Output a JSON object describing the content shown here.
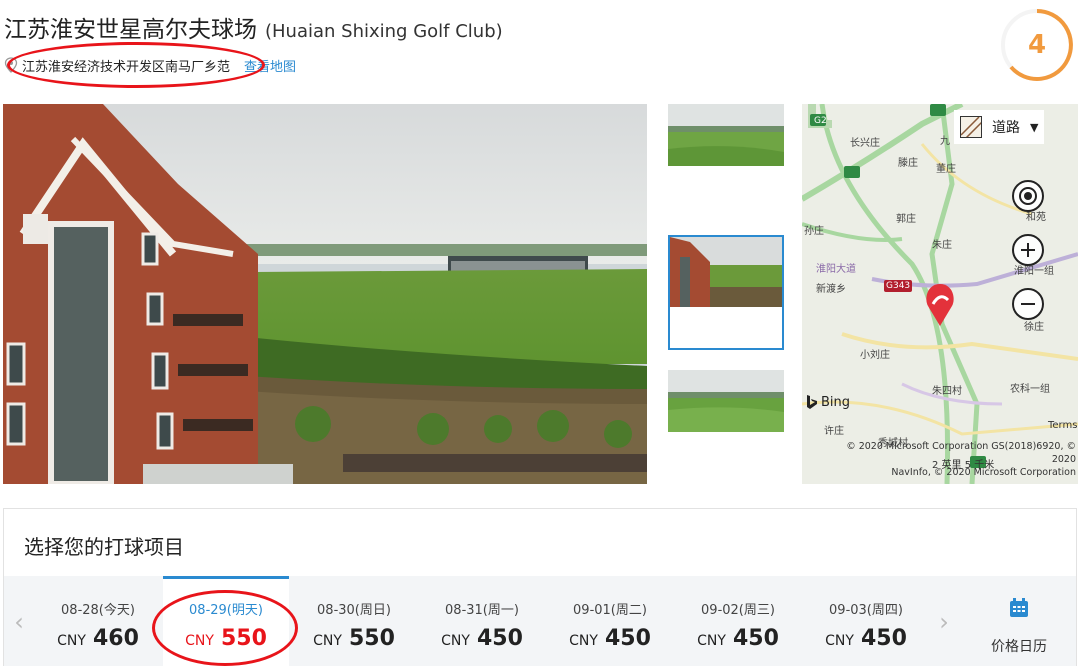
{
  "header": {
    "title_cn": "江苏淮安世星高尔夫球场",
    "title_en": "(Huaian Shixing Golf Club)",
    "address": "江苏淮安经济技术开发区南马厂乡范",
    "map_link": "查看地图",
    "score": "4"
  },
  "map": {
    "style_label": "道路",
    "labels": [
      "长兴庄",
      "九",
      "滕庄",
      "董庄",
      "孙庄",
      "郭庄",
      "朱庄",
      "淮阳大道",
      "新渡乡",
      "小刘庄",
      "朱四村",
      "农科一组",
      "许庄",
      "秀城村",
      "G2",
      "G343",
      "淮阳一组",
      "徐庄",
      "和苑"
    ],
    "provider": "Bing",
    "terms": "Terms",
    "copyright_line1": "© 2020 Microsoft Corporation GS(2018)6920, © 2020",
    "copyright_line2": "NavInfo, © 2020 Microsoft Corporation",
    "scale": "2 英里      5 千米"
  },
  "booking": {
    "section_title": "选择您的打球项目",
    "days": [
      {
        "date": "08-28(今天)",
        "currency": "CNY",
        "price": "460"
      },
      {
        "date": "08-29(明天)",
        "currency": "CNY",
        "price": "550"
      },
      {
        "date": "08-30(周日)",
        "currency": "CNY",
        "price": "550"
      },
      {
        "date": "08-31(周一)",
        "currency": "CNY",
        "price": "450"
      },
      {
        "date": "09-01(周二)",
        "currency": "CNY",
        "price": "450"
      },
      {
        "date": "09-02(周三)",
        "currency": "CNY",
        "price": "450"
      },
      {
        "date": "09-03(周四)",
        "currency": "CNY",
        "price": "450"
      }
    ],
    "selected_index": 1,
    "calendar_label": "价格日历"
  },
  "colors": {
    "accent": "#2a8ad0",
    "highlight": "#e8141a",
    "score": "#f19a3e"
  }
}
